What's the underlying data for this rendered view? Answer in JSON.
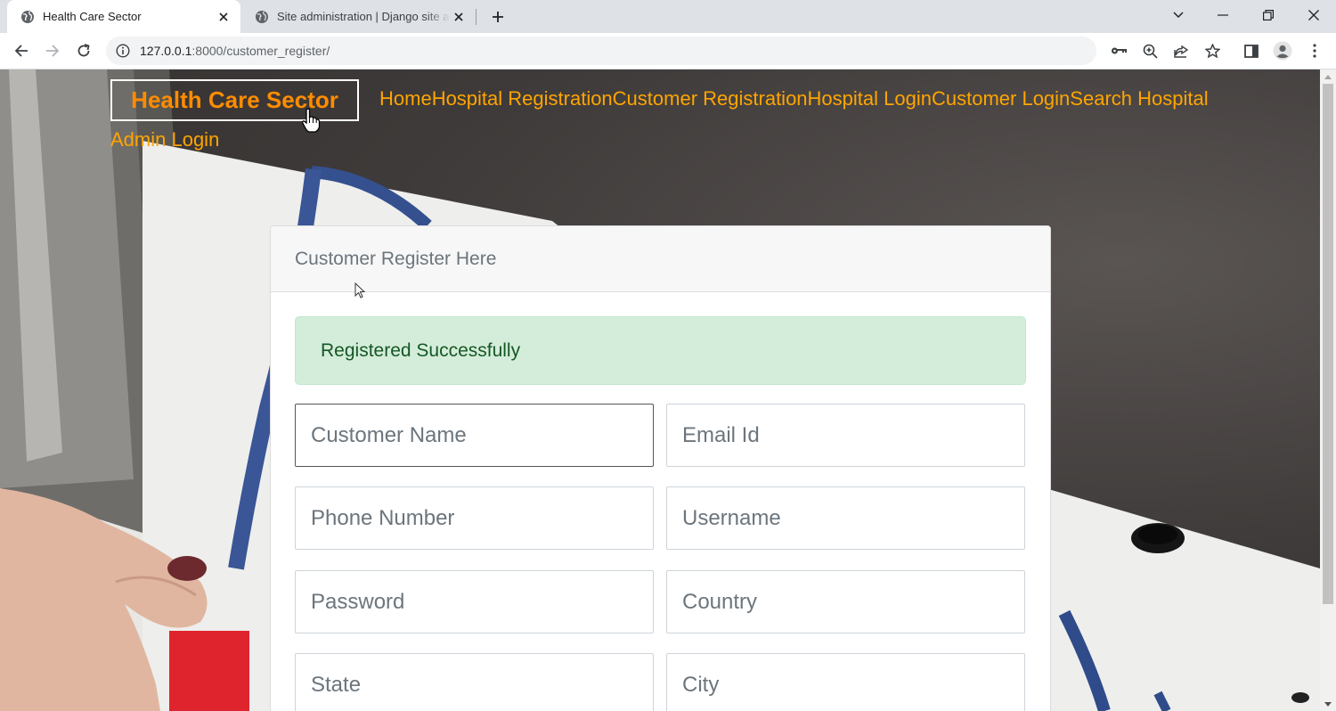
{
  "browser": {
    "tabs": [
      {
        "title": "Health Care Sector",
        "active": true
      },
      {
        "title": "Site administration | Django site admin",
        "active": false
      }
    ],
    "url_host": "127.0.0.1",
    "url_path": ":8000/customer_register/"
  },
  "site": {
    "brand": "Health Care Sector",
    "nav": [
      "Home",
      "Hospital Registration",
      "Customer Registration",
      "Hospital Login",
      "Customer Login",
      "Search Hospital"
    ],
    "admin_link": "Admin Login"
  },
  "form": {
    "title": "Customer Register Here",
    "alert": "Registered Successfully",
    "fields": {
      "customer_name": "Customer Name",
      "email": "Email Id",
      "phone": "Phone Number",
      "username": "Username",
      "password": "Password",
      "country": "Country",
      "state": "State",
      "city": "City"
    }
  },
  "colors": {
    "nav_link": "#ffa500",
    "brand": "#ff8c00",
    "alert_bg": "#d4edda",
    "alert_text": "#155724"
  }
}
